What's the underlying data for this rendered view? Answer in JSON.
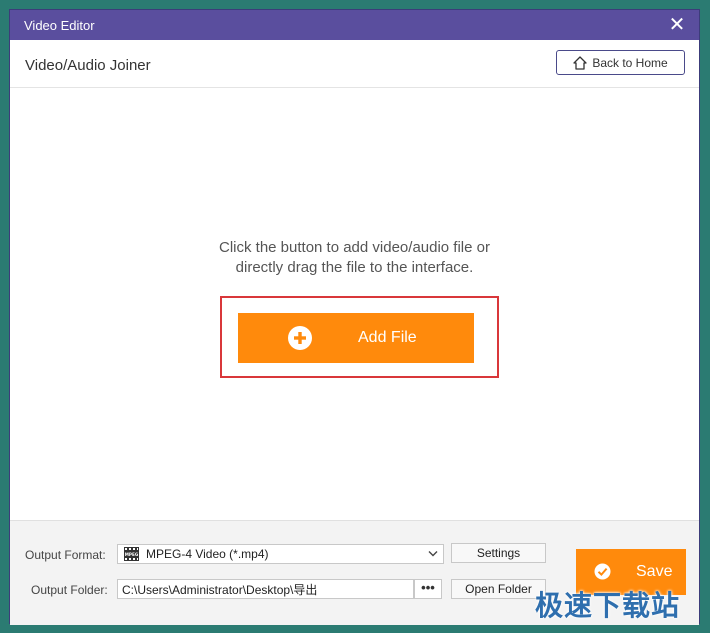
{
  "window": {
    "title": "Video Editor",
    "close_label": "✕"
  },
  "header": {
    "title": "Video/Audio Joiner",
    "back_label": "Back to Home"
  },
  "main": {
    "hint_line1": "Click the button to add video/audio file or",
    "hint_line2": "directly drag the file to the interface.",
    "add_file_label": "Add File"
  },
  "footer": {
    "output_format_label": "Output Format:",
    "output_format_value": "MPEG-4 Video (*.mp4)",
    "format_icon_text": "MPEG",
    "settings_label": "Settings",
    "output_folder_label": "Output Folder:",
    "output_folder_value": "C:\\Users\\Administrator\\Desktop\\导出",
    "browse_label": "•••",
    "open_folder_label": "Open Folder",
    "save_label": "Save"
  },
  "watermark": {
    "text": "极速下载站"
  },
  "colors": {
    "titlebar": "#5a4e9e",
    "accent": "#ff8a0c",
    "highlight_frame": "#d9373a"
  },
  "icons": {
    "back": "home-icon",
    "add": "plus-circle-icon",
    "save": "check-circle-icon",
    "format": "mpeg-format-icon",
    "dropdown": "chevron-down-icon"
  }
}
